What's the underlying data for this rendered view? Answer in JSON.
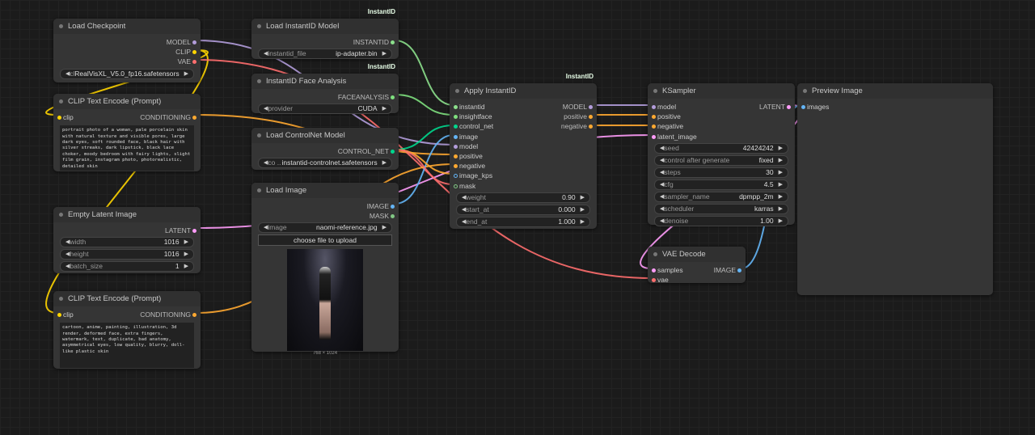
{
  "colors": {
    "model": "#b39ddb",
    "clip": "#ffd500",
    "vae": "#ff6e6e",
    "conditioning": "#ffa931",
    "latent": "#ff9cf9",
    "instantid": "#8ce08c",
    "faceanalysis": "#7ee07e",
    "control_net": "#00d78d",
    "image": "#64b5f6",
    "mask": "#81c784"
  },
  "nodes": [
    {
      "id": "load-checkpoint",
      "title": "Load Checkpoint",
      "inputs": [],
      "outputs": [
        {
          "label": "MODEL",
          "type": "model"
        },
        {
          "label": "CLIP",
          "type": "clip"
        },
        {
          "label": "VAE",
          "type": "vae"
        }
      ],
      "widgets": [
        {
          "label": "ck ...",
          "value": "RealVisXL_V5.0_fp16.safetensors"
        }
      ]
    },
    {
      "id": "clip-text-encode-positive",
      "title": "CLIP Text Encode (Prompt)",
      "inputs": [
        {
          "label": "clip",
          "type": "clip"
        }
      ],
      "outputs": [
        {
          "label": "CONDITIONING",
          "type": "conditioning"
        }
      ],
      "text": "portrait photo of a woman, pale porcelain skin with natural texture and visible pores, large dark eyes, soft rounded face, black hair with silver streaks, dark lipstick, black lace choker, moody bedroom with fairy lights, slight film grain, instagram photo, photorealistic, detailed skin"
    },
    {
      "id": "empty-latent-image",
      "title": "Empty Latent Image",
      "inputs": [],
      "outputs": [
        {
          "label": "LATENT",
          "type": "latent"
        }
      ],
      "widgets": [
        {
          "label": "width",
          "value": "1016"
        },
        {
          "label": "height",
          "value": "1016"
        },
        {
          "label": "batch_size",
          "value": "1"
        }
      ]
    },
    {
      "id": "clip-text-encode-negative",
      "title": "CLIP Text Encode (Prompt)",
      "inputs": [
        {
          "label": "clip",
          "type": "clip"
        }
      ],
      "outputs": [
        {
          "label": "CONDITIONING",
          "type": "conditioning"
        }
      ],
      "text": "cartoon, anime, painting, illustration, 3d render, deformed face, extra fingers, watermark, text, duplicate, bad anatomy, asymmetrical eyes, low quality, blurry, doll-like plastic skin"
    },
    {
      "id": "load-instantid-model",
      "title": "Load InstantID Model",
      "badge": "InstantID",
      "inputs": [],
      "outputs": [
        {
          "label": "INSTANTID",
          "type": "instantid"
        }
      ],
      "widgets": [
        {
          "label": "instantid_file",
          "value": "ip-adapter.bin"
        }
      ]
    },
    {
      "id": "instantid-face-analysis",
      "title": "InstantID Face Analysis",
      "badge": "InstantID",
      "inputs": [],
      "outputs": [
        {
          "label": "FACEANALYSIS",
          "type": "faceanalysis"
        }
      ],
      "widgets": [
        {
          "label": "provider",
          "value": "CUDA"
        }
      ]
    },
    {
      "id": "load-controlnet-model",
      "title": "Load ControlNet Model",
      "inputs": [],
      "outputs": [
        {
          "label": "CONTROL_NET",
          "type": "control_net"
        }
      ],
      "widgets": [
        {
          "label": "co ...",
          "value": "instantid-controlnet.safetensors"
        }
      ]
    },
    {
      "id": "load-image",
      "title": "Load Image",
      "inputs": [],
      "outputs": [
        {
          "label": "IMAGE",
          "type": "image"
        },
        {
          "label": "MASK",
          "type": "mask"
        }
      ],
      "widgets": [
        {
          "label": "image",
          "value": "naomi-reference.jpg"
        }
      ],
      "button": "choose file to upload",
      "image_size": "768 × 1024"
    },
    {
      "id": "apply-instantid",
      "title": "Apply InstantID",
      "badge": "InstantID",
      "inputs": [
        {
          "label": "instantid",
          "type": "instantid"
        },
        {
          "label": "insightface",
          "type": "faceanalysis"
        },
        {
          "label": "control_net",
          "type": "control_net"
        },
        {
          "label": "image",
          "type": "image"
        },
        {
          "label": "model",
          "type": "model"
        },
        {
          "label": "positive",
          "type": "conditioning"
        },
        {
          "label": "negative",
          "type": "conditioning"
        },
        {
          "label": "image_kps",
          "type": "image"
        },
        {
          "label": "mask",
          "type": "mask"
        }
      ],
      "outputs": [
        {
          "label": "MODEL",
          "type": "model"
        },
        {
          "label": "positive",
          "type": "conditioning"
        },
        {
          "label": "negative",
          "type": "conditioning"
        }
      ],
      "widgets": [
        {
          "label": "weight",
          "value": "0.90"
        },
        {
          "label": "start_at",
          "value": "0.000"
        },
        {
          "label": "end_at",
          "value": "1.000"
        }
      ]
    },
    {
      "id": "ksampler",
      "title": "KSampler",
      "inputs": [
        {
          "label": "model",
          "type": "model"
        },
        {
          "label": "positive",
          "type": "conditioning"
        },
        {
          "label": "negative",
          "type": "conditioning"
        },
        {
          "label": "latent_image",
          "type": "latent"
        }
      ],
      "outputs": [
        {
          "label": "LATENT",
          "type": "latent"
        }
      ],
      "widgets": [
        {
          "label": "seed",
          "value": "42424242"
        },
        {
          "label": "control after generate",
          "value": "fixed"
        },
        {
          "label": "steps",
          "value": "30"
        },
        {
          "label": "cfg",
          "value": "4.5"
        },
        {
          "label": "sampler_name",
          "value": "dpmpp_2m"
        },
        {
          "label": "scheduler",
          "value": "karras"
        },
        {
          "label": "denoise",
          "value": "1.00"
        }
      ]
    },
    {
      "id": "vae-decode",
      "title": "VAE Decode",
      "inputs": [
        {
          "label": "samples",
          "type": "latent"
        },
        {
          "label": "vae",
          "type": "vae"
        }
      ],
      "outputs": [
        {
          "label": "IMAGE",
          "type": "image"
        }
      ]
    },
    {
      "id": "preview-image",
      "title": "Preview Image",
      "inputs": [
        {
          "label": "images",
          "type": "image"
        }
      ],
      "outputs": []
    }
  ]
}
